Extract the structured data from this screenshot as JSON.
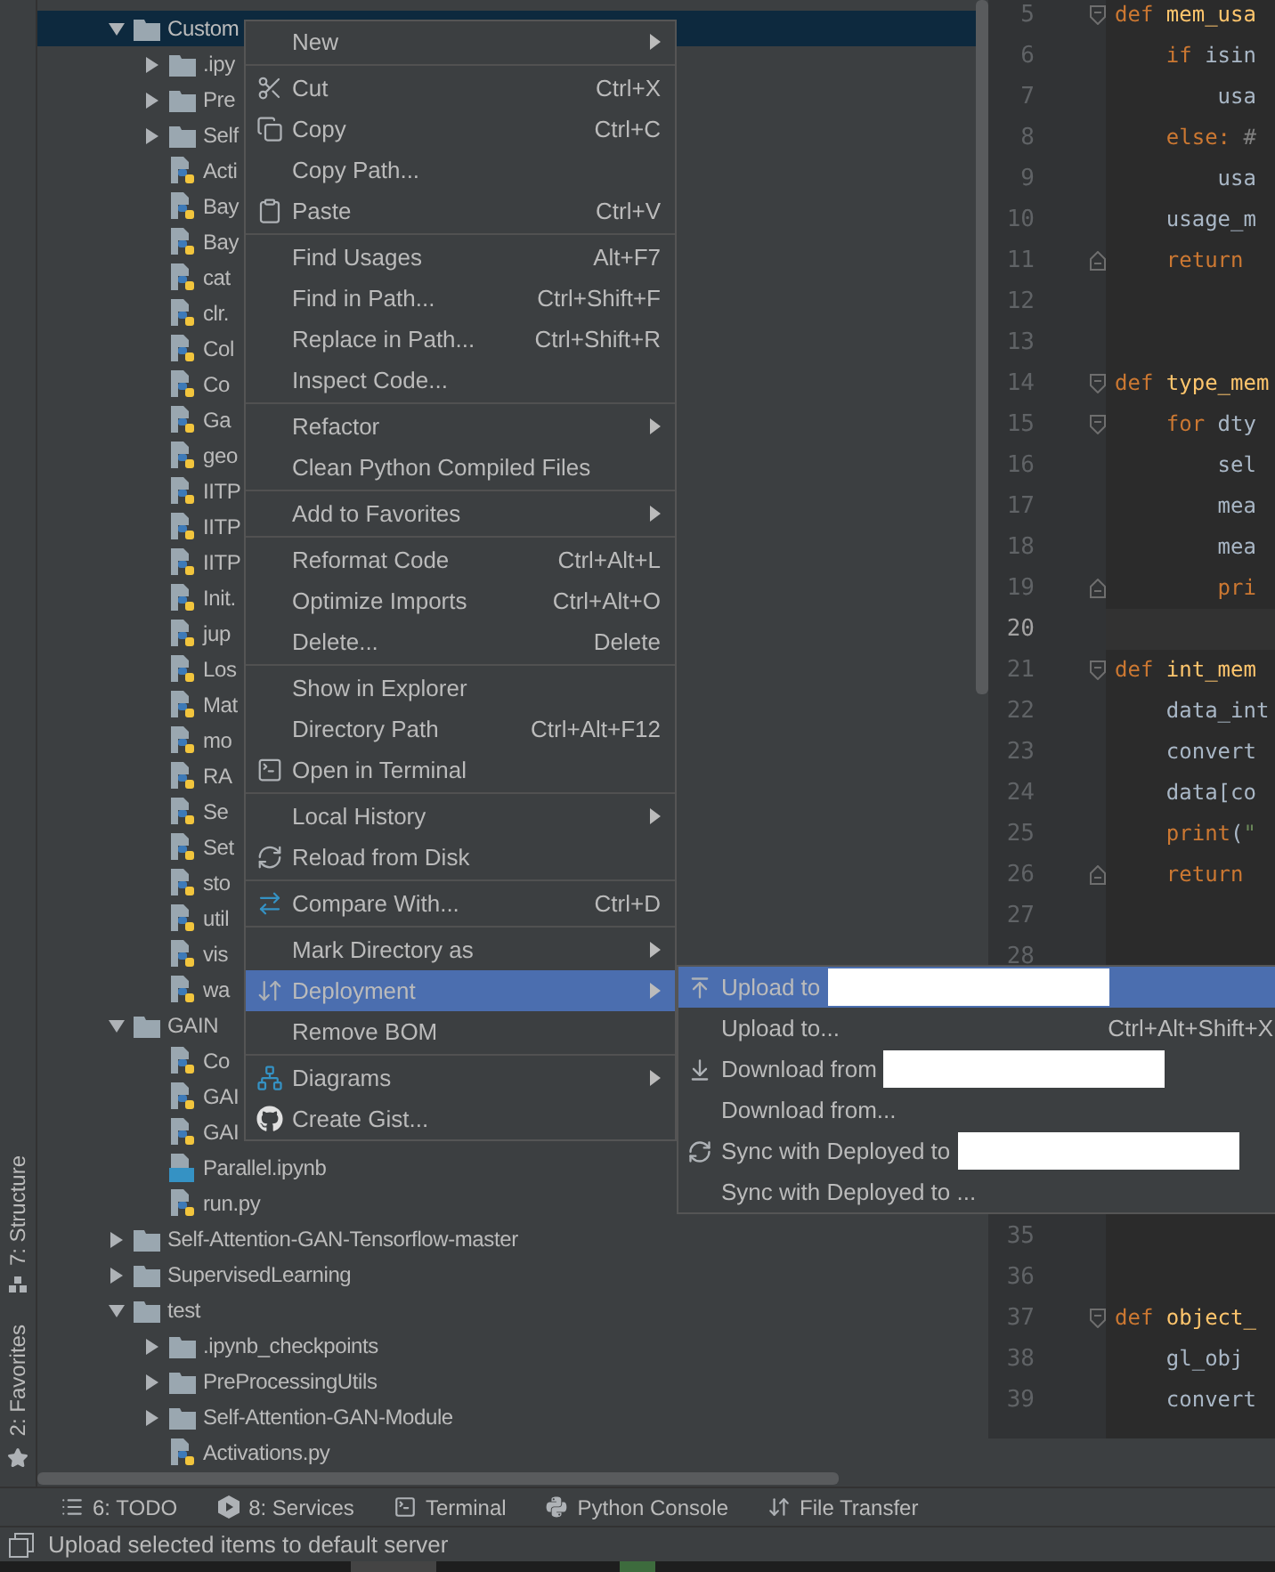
{
  "tool_strip": [
    {
      "label": "7: Structure"
    },
    {
      "label": "2: Favorites"
    }
  ],
  "tree": [
    {
      "name": "Custom",
      "kind": "folder",
      "expanded": true,
      "selected": true,
      "children": [
        {
          "name": ".ipy",
          "kind": "folder",
          "expanded": false,
          "selected": false
        },
        {
          "name": "Pre",
          "kind": "folder",
          "expanded": false,
          "selected": false
        },
        {
          "name": "Self",
          "kind": "folder",
          "expanded": false,
          "selected": false
        },
        {
          "name": "Acti",
          "kind": "python",
          "selected": false
        },
        {
          "name": "Bay",
          "kind": "python",
          "selected": false
        },
        {
          "name": "Bay",
          "kind": "python",
          "selected": false
        },
        {
          "name": "cat",
          "kind": "python",
          "selected": false
        },
        {
          "name": "clr.",
          "kind": "python",
          "selected": false
        },
        {
          "name": "Col",
          "kind": "python",
          "selected": false
        },
        {
          "name": "Co",
          "kind": "python",
          "selected": false
        },
        {
          "name": "Ga",
          "kind": "python",
          "selected": false
        },
        {
          "name": "geo",
          "kind": "python",
          "selected": false
        },
        {
          "name": "IITP",
          "kind": "python",
          "selected": false
        },
        {
          "name": "IITP",
          "kind": "python",
          "selected": false
        },
        {
          "name": "IITP",
          "kind": "python",
          "selected": false
        },
        {
          "name": "Init.",
          "kind": "python",
          "selected": false
        },
        {
          "name": "jup",
          "kind": "python",
          "selected": false
        },
        {
          "name": "Los",
          "kind": "python",
          "selected": false
        },
        {
          "name": "Mat",
          "kind": "python",
          "selected": false
        },
        {
          "name": "mo",
          "kind": "python",
          "selected": false
        },
        {
          "name": "RA",
          "kind": "python",
          "selected": false
        },
        {
          "name": "Se",
          "kind": "python",
          "selected": false
        },
        {
          "name": "Set",
          "kind": "python",
          "selected": false
        },
        {
          "name": "sto",
          "kind": "python",
          "selected": false
        },
        {
          "name": "util",
          "kind": "python",
          "selected": false
        },
        {
          "name": "vis",
          "kind": "python",
          "selected": false
        },
        {
          "name": "wa",
          "kind": "python",
          "selected": false
        }
      ]
    },
    {
      "name": "GAIN",
      "kind": "folder",
      "expanded": true,
      "selected": false,
      "children": [
        {
          "name": "Co",
          "kind": "python",
          "selected": false
        },
        {
          "name": "GAI",
          "kind": "python",
          "selected": false
        },
        {
          "name": "GAI",
          "kind": "python",
          "selected": false
        },
        {
          "name": "Parallel.ipynb",
          "kind": "notebook",
          "selected": false
        },
        {
          "name": "run.py",
          "kind": "python",
          "selected": false
        }
      ]
    },
    {
      "name": "Self-Attention-GAN-Tensorflow-master",
      "kind": "folder",
      "expanded": false,
      "selected": false
    },
    {
      "name": "SupervisedLearning",
      "kind": "folder",
      "expanded": false,
      "selected": false
    },
    {
      "name": "test",
      "kind": "folder",
      "expanded": true,
      "selected": false,
      "children": [
        {
          "name": ".ipynb_checkpoints",
          "kind": "folder",
          "expanded": false,
          "selected": false
        },
        {
          "name": "PreProcessingUtils",
          "kind": "folder",
          "expanded": false,
          "selected": false
        },
        {
          "name": "Self-Attention-GAN-Module",
          "kind": "folder",
          "expanded": false,
          "selected": false
        },
        {
          "name": "Activations.py",
          "kind": "python",
          "selected": false
        }
      ]
    }
  ],
  "editor": {
    "segments": [
      {
        "lines": [
          {
            "number": "5",
            "current": false,
            "kind": "fold_start",
            "tokens": [
              {
                "text": "def ",
                "kind": "keyword"
              },
              {
                "text": "mem_usa",
                "kind": "function"
              }
            ]
          },
          {
            "number": "6",
            "current": false,
            "kind": "plain",
            "tokens": [
              {
                "text": "    if ",
                "kind": "keyword"
              },
              {
                "text": "isin",
                "kind": "plain"
              }
            ]
          },
          {
            "number": "7",
            "current": false,
            "kind": "plain",
            "tokens": [
              {
                "text": "        usa",
                "kind": "plain"
              }
            ]
          },
          {
            "number": "8",
            "current": false,
            "kind": "plain",
            "tokens": [
              {
                "text": "    else:",
                "kind": "keyword"
              },
              {
                "text": " #",
                "kind": "comment"
              }
            ]
          },
          {
            "number": "9",
            "current": false,
            "kind": "plain",
            "tokens": [
              {
                "text": "        usa",
                "kind": "plain"
              }
            ]
          },
          {
            "number": "10",
            "current": false,
            "kind": "plain",
            "tokens": [
              {
                "text": "    usage_m",
                "kind": "plain"
              }
            ]
          },
          {
            "number": "11",
            "current": false,
            "kind": "fold_end",
            "tokens": [
              {
                "text": "    return",
                "kind": "keyword"
              }
            ]
          },
          {
            "number": "12",
            "current": false,
            "kind": "plain"
          },
          {
            "number": "13",
            "current": false,
            "kind": "plain"
          },
          {
            "number": "14",
            "current": false,
            "kind": "fold_start",
            "tokens": [
              {
                "text": "def ",
                "kind": "keyword"
              },
              {
                "text": "type_mem",
                "kind": "function"
              }
            ]
          },
          {
            "number": "15",
            "current": false,
            "kind": "fold_start",
            "tokens": [
              {
                "text": "    for ",
                "kind": "keyword"
              },
              {
                "text": "dty",
                "kind": "plain"
              }
            ]
          },
          {
            "number": "16",
            "current": false,
            "kind": "plain",
            "tokens": [
              {
                "text": "        sel",
                "kind": "plain"
              }
            ]
          },
          {
            "number": "17",
            "current": false,
            "kind": "plain",
            "tokens": [
              {
                "text": "        mea",
                "kind": "plain"
              }
            ]
          },
          {
            "number": "18",
            "current": false,
            "kind": "plain",
            "tokens": [
              {
                "text": "        mea",
                "kind": "plain"
              }
            ]
          },
          {
            "number": "19",
            "current": false,
            "kind": "fold_end",
            "tokens": [
              {
                "text": "        pri",
                "kind": "keyword"
              }
            ]
          },
          {
            "number": "20",
            "current": true,
            "kind": "plain"
          },
          {
            "number": "21",
            "current": false,
            "kind": "fold_start",
            "tokens": [
              {
                "text": "def ",
                "kind": "keyword"
              },
              {
                "text": "int_mem",
                "kind": "function"
              }
            ]
          },
          {
            "number": "22",
            "current": false,
            "kind": "plain",
            "tokens": [
              {
                "text": "    data_int",
                "kind": "plain"
              }
            ]
          },
          {
            "number": "23",
            "current": false,
            "kind": "plain",
            "tokens": [
              {
                "text": "    convert",
                "kind": "plain"
              }
            ]
          },
          {
            "number": "24",
            "current": false,
            "kind": "plain",
            "tokens": [
              {
                "text": "    data[co",
                "kind": "plain"
              }
            ]
          },
          {
            "number": "25",
            "current": false,
            "kind": "plain",
            "tokens": [
              {
                "text": "    print",
                "kind": "keyword"
              },
              {
                "text": "(",
                "kind": "plain"
              },
              {
                "text": "\"",
                "kind": "string"
              }
            ]
          },
          {
            "number": "26",
            "current": false,
            "kind": "fold_end",
            "tokens": [
              {
                "text": "    return",
                "kind": "keyword"
              }
            ]
          },
          {
            "number": "27",
            "current": false,
            "kind": "plain"
          },
          {
            "number": "28",
            "current": false,
            "kind": "plain"
          }
        ]
      },
      {
        "lines": [
          {
            "number": "35",
            "current": false,
            "kind": "plain"
          },
          {
            "number": "36",
            "current": false,
            "kind": "plain"
          },
          {
            "number": "37",
            "current": false,
            "kind": "fold_start",
            "tokens": [
              {
                "text": "def ",
                "kind": "keyword"
              },
              {
                "text": "object_",
                "kind": "function"
              }
            ]
          },
          {
            "number": "38",
            "current": false,
            "kind": "plain",
            "tokens": [
              {
                "text": "    gl_obj",
                "kind": "plain"
              }
            ]
          },
          {
            "number": "39",
            "current": false,
            "kind": "plain",
            "tokens": [
              {
                "text": "    convert",
                "kind": "plain"
              }
            ]
          }
        ]
      }
    ]
  },
  "context_menu": {
    "sections": [
      {
        "items": [
          {
            "label": "New",
            "has_submenu": true,
            "selected": false
          }
        ]
      },
      {
        "items": [
          {
            "label": "Cut",
            "shortcut": "Ctrl+X",
            "has_submenu": false,
            "selected": false
          },
          {
            "label": "Copy",
            "shortcut": "Ctrl+C",
            "has_submenu": false,
            "selected": false
          },
          {
            "label": "Copy Path...",
            "has_submenu": false,
            "selected": false
          },
          {
            "label": "Paste",
            "shortcut": "Ctrl+V",
            "has_submenu": false,
            "selected": false
          }
        ]
      },
      {
        "items": [
          {
            "label": "Find Usages",
            "shortcut": "Alt+F7",
            "has_submenu": false,
            "selected": false
          },
          {
            "label": "Find in Path...",
            "shortcut": "Ctrl+Shift+F",
            "has_submenu": false,
            "selected": false
          },
          {
            "label": "Replace in Path...",
            "shortcut": "Ctrl+Shift+R",
            "has_submenu": false,
            "selected": false
          },
          {
            "label": "Inspect Code...",
            "has_submenu": false,
            "selected": false
          }
        ]
      },
      {
        "items": [
          {
            "label": "Refactor",
            "has_submenu": true,
            "selected": false
          },
          {
            "label": "Clean Python Compiled Files",
            "has_submenu": false,
            "selected": false
          }
        ]
      },
      {
        "items": [
          {
            "label": "Add to Favorites",
            "has_submenu": true,
            "selected": false
          }
        ]
      },
      {
        "items": [
          {
            "label": "Reformat Code",
            "shortcut": "Ctrl+Alt+L",
            "has_submenu": false,
            "selected": false
          },
          {
            "label": "Optimize Imports",
            "shortcut": "Ctrl+Alt+O",
            "has_submenu": false,
            "selected": false
          },
          {
            "label": "Delete...",
            "shortcut": "Delete",
            "has_submenu": false,
            "selected": false
          }
        ]
      },
      {
        "items": [
          {
            "label": "Show in Explorer",
            "has_submenu": false,
            "selected": false
          },
          {
            "label": "Directory Path",
            "shortcut": "Ctrl+Alt+F12",
            "has_submenu": false,
            "selected": false
          },
          {
            "label": "Open in Terminal",
            "has_submenu": false,
            "selected": false
          }
        ]
      },
      {
        "items": [
          {
            "label": "Local History",
            "has_submenu": true,
            "selected": false
          },
          {
            "label": "Reload from Disk",
            "has_submenu": false,
            "selected": false
          }
        ]
      },
      {
        "items": [
          {
            "label": "Compare With...",
            "shortcut": "Ctrl+D",
            "has_submenu": false,
            "selected": false
          }
        ]
      },
      {
        "items": [
          {
            "label": "Mark Directory as",
            "has_submenu": true,
            "selected": false
          },
          {
            "label": "Deployment",
            "has_submenu": true,
            "selected": true
          },
          {
            "label": "Remove BOM",
            "has_submenu": false,
            "selected": false
          }
        ]
      },
      {
        "items": [
          {
            "label": "Diagrams",
            "has_submenu": true,
            "selected": false
          },
          {
            "label": "Create Gist...",
            "has_submenu": false,
            "selected": false
          }
        ]
      }
    ]
  },
  "submenu": {
    "items": [
      {
        "label": "Upload to",
        "redacted": true,
        "selected": true
      },
      {
        "label": "Upload to...",
        "shortcut": "Ctrl+Alt+Shift+X",
        "redacted": false,
        "selected": false
      },
      {
        "label": "Download from",
        "redacted": true,
        "selected": false
      },
      {
        "label": "Download from...",
        "redacted": false,
        "selected": false
      },
      {
        "label": "Sync with Deployed to",
        "redacted": true,
        "selected": false
      },
      {
        "label": "Sync with Deployed to ...",
        "redacted": false,
        "selected": false
      }
    ]
  },
  "tool_windows": [
    {
      "label": "6: TODO"
    },
    {
      "label": "8: Services"
    },
    {
      "label": "Terminal"
    },
    {
      "label": "Python Console"
    },
    {
      "label": "File Transfer"
    }
  ],
  "status_bar": {
    "message": "Upload selected items to default server"
  }
}
